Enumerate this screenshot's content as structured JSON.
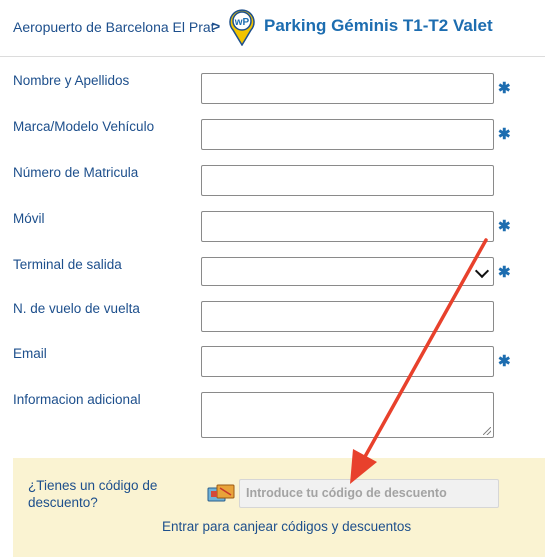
{
  "header": {
    "breadcrumb": "Aeropuerto de Barcelona El Prat",
    "separator": ">",
    "title": "Parking Géminis T1-T2 Valet",
    "logo_text": "wP"
  },
  "form": {
    "required_mark": "✱",
    "fields": [
      {
        "label": "Nombre y Apellidos",
        "value": "",
        "required": true
      },
      {
        "label": "Marca/Modelo Vehículo",
        "value": "",
        "required": true
      },
      {
        "label": "Número de Matricula",
        "value": "",
        "required": false
      },
      {
        "label": "Móvil",
        "value": "",
        "required": true
      },
      {
        "label": "Terminal de salida",
        "value": "",
        "required": true
      },
      {
        "label": "N. de vuelo de vuelta",
        "value": "",
        "required": false
      },
      {
        "label": "Email",
        "value": "",
        "required": true
      },
      {
        "label": "Informacion adicional",
        "value": "",
        "required": false
      }
    ]
  },
  "promo": {
    "question": "¿Tienes un código de descuento?",
    "placeholder": "Introduce tu código de descuento",
    "link": "Entrar para canjear códigos y descuentos"
  },
  "colors": {
    "primary": "#1d4f8c",
    "accent": "#1d6db0",
    "promo_bg": "#faf3d2",
    "annotation_arrow": "#e8412c"
  }
}
